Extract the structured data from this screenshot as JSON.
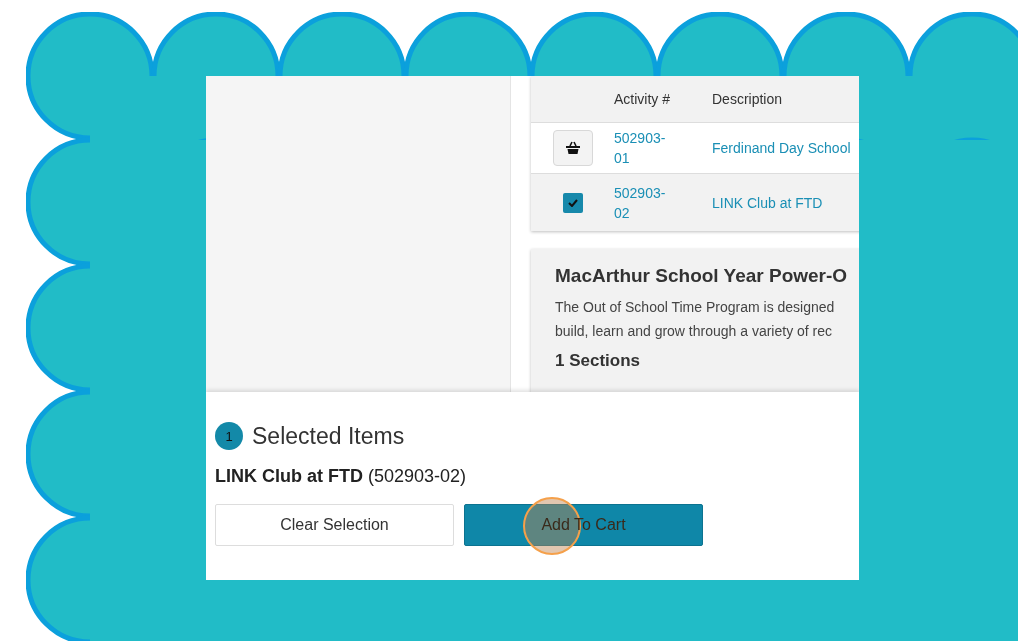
{
  "activities_table": {
    "columns": [
      "Activity #",
      "Description"
    ],
    "rows": [
      {
        "activity": "502903-\n01",
        "description": "Ferdinand Day School",
        "selected": false
      },
      {
        "activity": "502903-\n02",
        "description": "LINK Club at FTD",
        "selected": true
      }
    ]
  },
  "program_card": {
    "title": "MacArthur School Year Power-O",
    "description": [
      "The Out of School Time Program is designed",
      "build, learn and grow through a variety of rec"
    ],
    "sections": "1 Sections"
  },
  "selected_items": {
    "count": "1",
    "title": "Selected Items",
    "item": "**LINK Club at FTD** (502903-02)"
  },
  "buttons": [
    {
      "label": "Clear Selection",
      "kind": "secondary"
    },
    {
      "label": "Add To Cart",
      "kind": "primary"
    }
  ]
}
